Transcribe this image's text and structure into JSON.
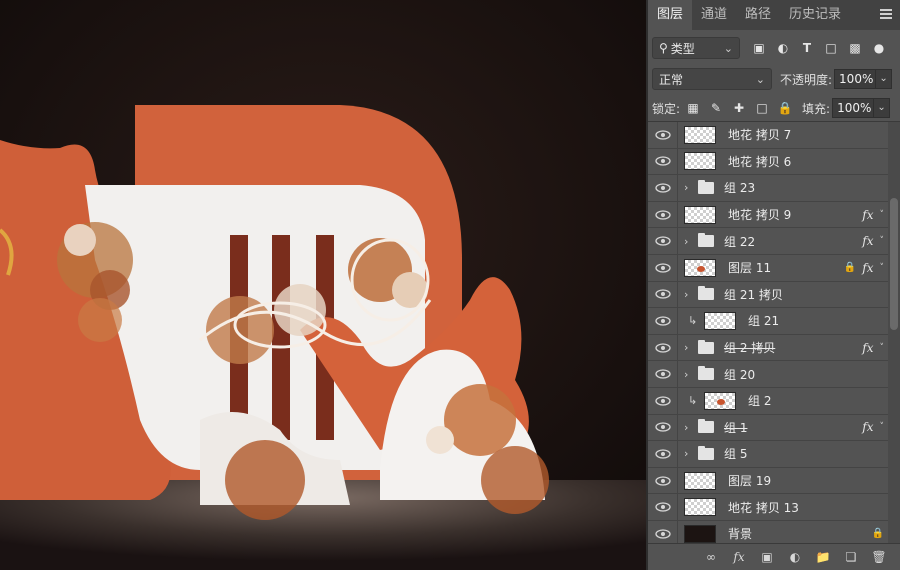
{
  "panel": {
    "tabs": [
      {
        "label": "图层",
        "active": true
      },
      {
        "label": "通道",
        "active": false
      },
      {
        "label": "路径",
        "active": false
      },
      {
        "label": "历史记录",
        "active": false
      }
    ],
    "filter": {
      "kind_label": "类型",
      "icons": [
        "image-filter-icon",
        "adjustment-filter-icon",
        "type-filter-icon",
        "shape-filter-icon",
        "smart-object-filter-icon",
        "filter-toggle-icon"
      ]
    },
    "blend_mode": "正常",
    "opacity_label": "不透明度:",
    "opacity_value": "100%",
    "lock_label": "锁定:",
    "fill_label": "填充:",
    "fill_value": "100%",
    "layers": [
      {
        "name": "地花 拷贝 7",
        "type": "layer",
        "fx": false,
        "lock": false,
        "clip": false,
        "strike": false,
        "thumb": "transparent"
      },
      {
        "name": "地花 拷贝 6",
        "type": "layer",
        "fx": false,
        "lock": false,
        "clip": false,
        "strike": false,
        "thumb": "transparent"
      },
      {
        "name": "组 23",
        "type": "group",
        "fx": false,
        "lock": false,
        "clip": false,
        "strike": false
      },
      {
        "name": "地花 拷贝 9",
        "type": "layer",
        "fx": true,
        "lock": false,
        "clip": false,
        "strike": false,
        "thumb": "transparent"
      },
      {
        "name": "组 22",
        "type": "group",
        "fx": true,
        "lock": false,
        "clip": false,
        "strike": false
      },
      {
        "name": "图层 11",
        "type": "layer",
        "fx": true,
        "lock": true,
        "clip": false,
        "strike": false,
        "thumb": "orange"
      },
      {
        "name": "组 21 拷贝",
        "type": "group",
        "fx": false,
        "lock": false,
        "clip": false,
        "strike": false
      },
      {
        "name": "组 21",
        "type": "layer",
        "fx": false,
        "lock": false,
        "clip": true,
        "strike": false,
        "thumb": "transparent"
      },
      {
        "name": "组 2 拷贝",
        "type": "group",
        "fx": true,
        "lock": false,
        "clip": false,
        "strike": true
      },
      {
        "name": "组 20",
        "type": "group",
        "fx": false,
        "lock": false,
        "clip": false,
        "strike": false
      },
      {
        "name": "组 2",
        "type": "layer",
        "fx": false,
        "lock": false,
        "clip": true,
        "strike": false,
        "thumb": "orange"
      },
      {
        "name": "组 1",
        "type": "group",
        "fx": true,
        "lock": false,
        "clip": false,
        "strike": true
      },
      {
        "name": "组 5",
        "type": "group",
        "fx": false,
        "lock": false,
        "clip": false,
        "strike": false
      },
      {
        "name": "图层 19",
        "type": "layer",
        "fx": false,
        "lock": false,
        "clip": false,
        "strike": false,
        "thumb": "transparent"
      },
      {
        "name": "地花 拷贝 13",
        "type": "layer",
        "fx": false,
        "lock": false,
        "clip": false,
        "strike": false,
        "thumb": "transparent"
      },
      {
        "name": "背景",
        "type": "layer",
        "fx": false,
        "lock": true,
        "clip": false,
        "strike": false,
        "thumb": "dark"
      }
    ],
    "bottom_icons": [
      "link-layers-icon",
      "fx-icon",
      "mask-icon",
      "adjustment-icon",
      "new-group-icon",
      "new-layer-icon",
      "delete-icon"
    ]
  },
  "colors": {
    "accent_orange": "#d4623a",
    "canvas_bg": "#1a1212",
    "panel_bg": "#535353"
  }
}
